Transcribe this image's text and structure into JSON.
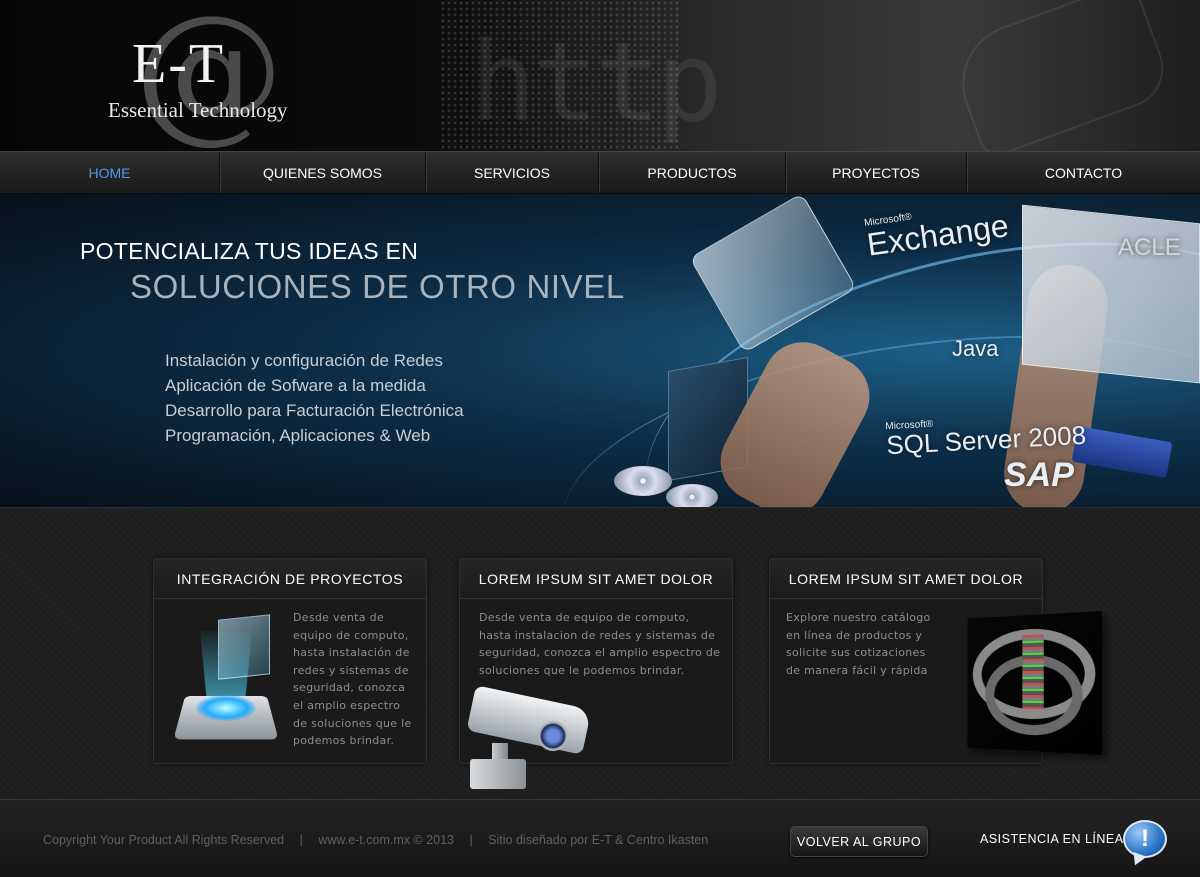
{
  "logo": {
    "mark": "E-T",
    "at_symbol": "@",
    "tagline": "Essential Technology"
  },
  "header": {
    "background_word": "http"
  },
  "nav": {
    "items": [
      {
        "label": "HOME",
        "active": true
      },
      {
        "label": "QUIENES SOMOS",
        "active": false
      },
      {
        "label": "SERVICIOS",
        "active": false
      },
      {
        "label": "PRODUCTOS",
        "active": false
      },
      {
        "label": "PROYECTOS",
        "active": false
      },
      {
        "label": "CONTACTO",
        "active": false
      }
    ],
    "active_color": "#4b9be8"
  },
  "banner": {
    "headline": "POTENCIALIZA TUS IDEAS EN",
    "subheadline": "SOLUCIONES DE OTRO NIVEL",
    "services": [
      "Instalación y configuración de Redes",
      "Aplicación de Sofware a la medida",
      "Desarrollo para Facturación Electrónica",
      "Programación, Aplicaciones & Web"
    ],
    "tech_labels": {
      "exchange_sup": "Microsoft®",
      "exchange": "Exchange",
      "oracle": "ACLE",
      "java": "Java",
      "sql_sup": "Microsoft®",
      "sql": "SQL Server 2008",
      "sap": "SAP"
    }
  },
  "cards": [
    {
      "title": "INTEGRACIÓN DE PROYECTOS",
      "text": "Desde venta de equipo de computo, hasta instalación de redes y sistemas de seguridad, conozca el amplio espectro de soluciones que le podemos brindar.",
      "icon": "hologram-folder-icon"
    },
    {
      "title": "LOREM IPSUM SIT AMET DOLOR",
      "text": "Desde venta de equipo de computo, hasta instalacion de redes y sistemas de seguridad, conozca el amplio espectro de soluciones que le podemos brindar.",
      "icon": "security-camera-icon"
    },
    {
      "title": "LOREM IPSUM SIT AMET DOLOR",
      "text": "Explore nuestro catálogo en línea de productos y solicite sus cotizaciones de manera fácil y rápida",
      "icon": "server-rack-image"
    }
  ],
  "footer": {
    "copyright": "Copyright Your Product All Rights Reserved",
    "website": "www.e-t.com.mx © 2013",
    "credits": "Sitio diseñado por E-T & Centro Ikasten",
    "separator": "|",
    "back_button": "VOLVER AL GRUPO",
    "assist_label": "ASISTENCIA EN LÍNEA",
    "assist_icon_glyph": "!"
  }
}
